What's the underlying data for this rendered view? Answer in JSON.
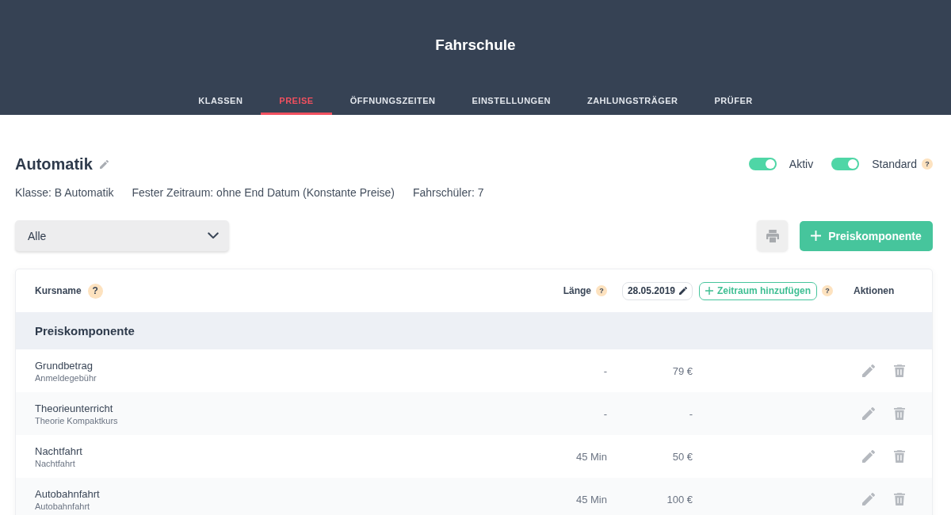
{
  "app": {
    "title": "Fahrschule"
  },
  "tabs": [
    {
      "label": "KLASSEN",
      "selected": false
    },
    {
      "label": "PREISE",
      "selected": true
    },
    {
      "label": "ÖFFNUNGSZEITEN",
      "selected": false
    },
    {
      "label": "EINSTELLUNGEN",
      "selected": false
    },
    {
      "label": "ZAHLUNGSTRÄGER",
      "selected": false
    },
    {
      "label": "PRÜFER",
      "selected": false
    }
  ],
  "course": {
    "title": "Automatik",
    "details": [
      "Klasse: B Automatik",
      "Fester Zeitraum: ohne End Datum (Konstante Preise)",
      "Fahrschüler: 7"
    ],
    "toggles": [
      {
        "label": "Aktiv",
        "on": true
      },
      {
        "label": "Standard",
        "on": true,
        "help": "?"
      }
    ]
  },
  "filter": {
    "value": "Alle"
  },
  "add_button": {
    "label": "Preiskomponente"
  },
  "table": {
    "columns": [
      {
        "label": "Kursname",
        "help": "?"
      },
      {
        "label": "Länge",
        "help": "?"
      }
    ],
    "period": {
      "date": "28.05.2019",
      "add_label": "Zeitraum hinzufügen",
      "help": "?"
    },
    "actions_label": "Aktionen",
    "groups": [
      {
        "title": "Preiskomponente",
        "rows": [
          {
            "name": "Grundbetrag",
            "subtitle": "Anmeldegebühr",
            "length": "-",
            "price": "79 €"
          },
          {
            "name": "Theorieunterricht",
            "subtitle": "Theorie Kompaktkurs",
            "length": "-",
            "price": "-"
          },
          {
            "name": "Nachtfahrt",
            "subtitle": "Nachtfahrt",
            "length": "45 Min",
            "price": "50 €"
          },
          {
            "name": "Autobahnfahrt",
            "subtitle": "Autobahnfahrt",
            "length": "45 Min",
            "price": "100 €"
          }
        ]
      }
    ]
  }
}
